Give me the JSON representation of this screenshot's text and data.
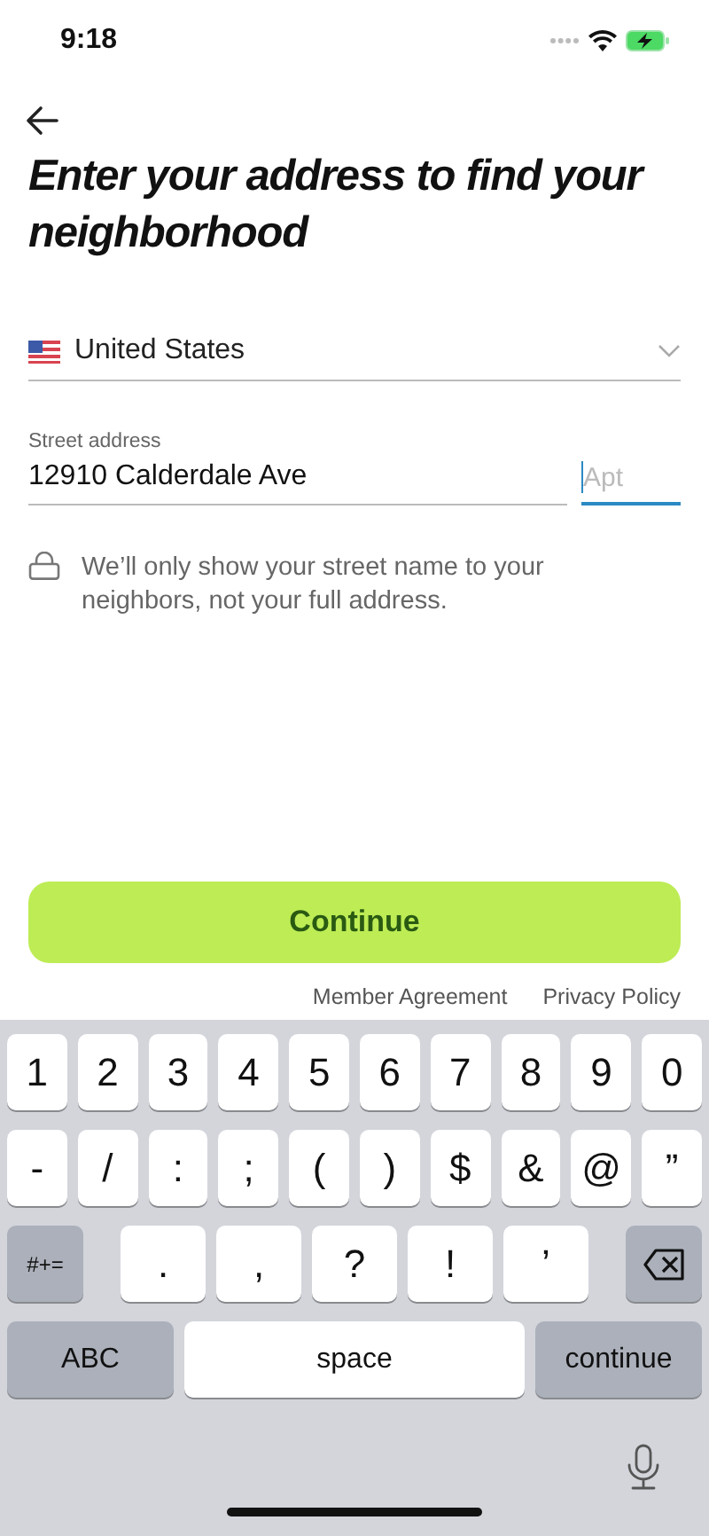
{
  "status_bar": {
    "time": "9:18"
  },
  "title": "Enter your address to find your neighborhood",
  "country": {
    "value": "United States"
  },
  "street": {
    "label": "Street address",
    "value": "12910 Calderdale Ave"
  },
  "apt": {
    "placeholder": "Apt",
    "focused": true
  },
  "privacy_note": "We’ll only show your street name to your neighbors, not your full address.",
  "continue_button": "Continue",
  "links": [
    "Member Agreement",
    "Privacy Policy"
  ],
  "keyboard": {
    "rows": [
      {
        "keys": [
          {
            "kind": "char",
            "label": "1"
          },
          {
            "kind": "char",
            "label": "2"
          },
          {
            "kind": "char",
            "label": "3"
          },
          {
            "kind": "char",
            "label": "4"
          },
          {
            "kind": "char",
            "label": "5"
          },
          {
            "kind": "char",
            "label": "6"
          },
          {
            "kind": "char",
            "label": "7"
          },
          {
            "kind": "char",
            "label": "8"
          },
          {
            "kind": "char",
            "label": "9"
          },
          {
            "kind": "char",
            "label": "0"
          }
        ]
      },
      {
        "keys": [
          {
            "kind": "char",
            "label": "-"
          },
          {
            "kind": "char",
            "label": "/"
          },
          {
            "kind": "char",
            "label": ":"
          },
          {
            "kind": "char",
            "label": ";"
          },
          {
            "kind": "char",
            "label": "("
          },
          {
            "kind": "char",
            "label": ")"
          },
          {
            "kind": "char",
            "label": "$"
          },
          {
            "kind": "char",
            "label": "&"
          },
          {
            "kind": "char",
            "label": "@"
          },
          {
            "kind": "char",
            "label": "”"
          }
        ]
      },
      {
        "keys": [
          {
            "kind": "shift",
            "label": "#+="
          },
          {
            "kind": "punct",
            "label": "."
          },
          {
            "kind": "punct",
            "label": ","
          },
          {
            "kind": "punct",
            "label": "?"
          },
          {
            "kind": "punct",
            "label": "!"
          },
          {
            "kind": "punct",
            "label": "’"
          },
          {
            "kind": "backspace"
          }
        ]
      },
      {
        "keys": [
          {
            "kind": "mode",
            "label": "ABC"
          },
          {
            "kind": "space",
            "label": "space"
          },
          {
            "kind": "return",
            "label": "continue"
          }
        ]
      }
    ]
  }
}
